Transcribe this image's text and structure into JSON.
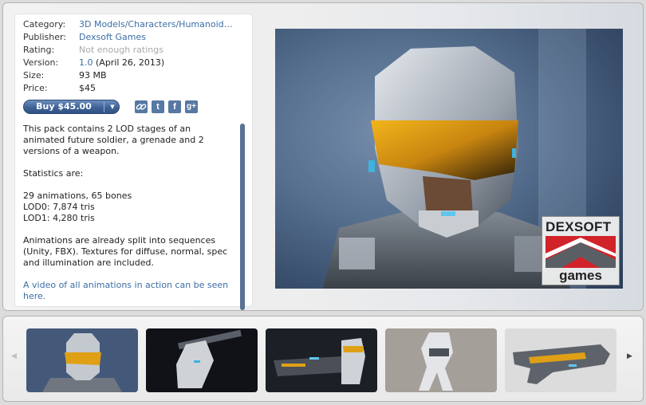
{
  "details": {
    "category_label": "Category:",
    "category_value": "3D Models/Characters/Humanoid…",
    "publisher_label": "Publisher:",
    "publisher_value": "Dexsoft Games",
    "rating_label": "Rating:",
    "rating_value": "Not enough ratings",
    "version_label": "Version:",
    "version_number": "1.0",
    "version_date": "(April 26, 2013)",
    "size_label": "Size:",
    "size_value": "93 MB",
    "price_label": "Price:",
    "price_value": "$45"
  },
  "buy": {
    "label": "Buy $45.00",
    "arrow": "▼"
  },
  "share": [
    {
      "name": "link-icon",
      "glyph": "⛓"
    },
    {
      "name": "twitter-icon",
      "glyph": "t"
    },
    {
      "name": "facebook-icon",
      "glyph": "f"
    },
    {
      "name": "google-plus-icon",
      "glyph": "g+"
    }
  ],
  "description": {
    "p1": "This pack contains 2 LOD stages of an animated future soldier, a grenade and 2 versions of a weapon.",
    "p2": "Statistics are:",
    "stat1": "29 animations, 65 bones",
    "stat2": "LOD0: 7,874 tris",
    "stat3": "LOD1: 4,280 tris",
    "p3": "Animations are already split into sequences (Unity, FBX). Textures for diffuse, normal, spec and illumination are included.",
    "video_link": "A video of all animations in action can be seen here."
  },
  "hero": {
    "logo_top": "DEXSOFT",
    "logo_bottom": "games"
  },
  "thumbnails": {
    "prev_arrow": "◀",
    "next_arrow": "▶",
    "count": 5
  },
  "colors": {
    "link": "#3b6ea5",
    "button": "#3f6398",
    "logo_red": "#d1232a"
  }
}
